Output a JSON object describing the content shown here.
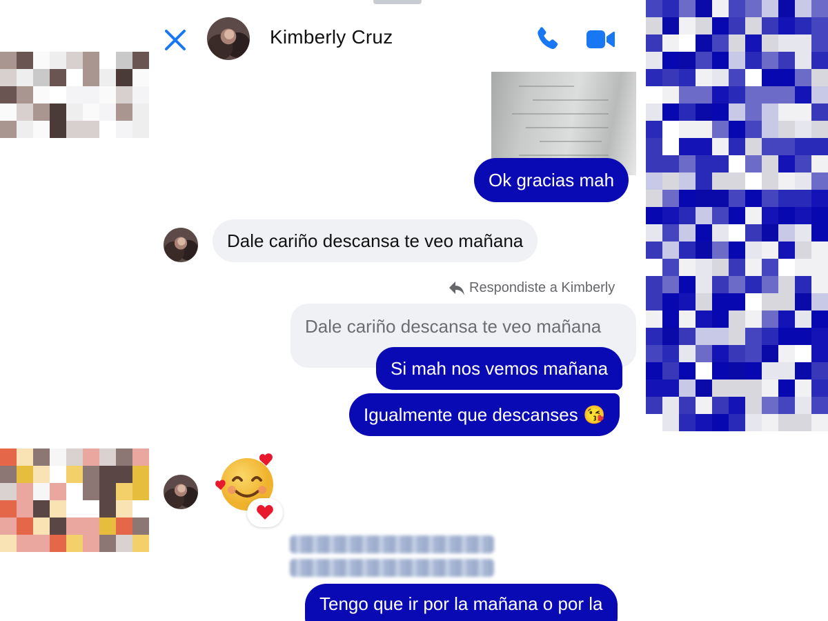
{
  "header": {
    "contact_name": "Kimberly Cruz"
  },
  "icons": {
    "close": "close-icon",
    "call": "phone-icon",
    "video": "video-camera-icon",
    "reply": "reply-arrow-icon"
  },
  "messages": {
    "out_1": "Ok gracias mah",
    "in_1": "Dale cariño descansa te veo mañana",
    "reply_label": "Respondiste a Kimberly",
    "quoted_text": "Dale cariño descansa te veo mañana",
    "out_2": "Si mah nos vemos mañana",
    "out_3": "Igualmente que descanses 😘",
    "in_emoji": "🥰",
    "reaction": "❤️",
    "out_4": "Tengo que ir por la mañana o por la"
  },
  "colors": {
    "accent_blue": "#1877f2",
    "outgoing_bubble": "#0a0ab4",
    "incoming_bubble": "#f0f1f4"
  }
}
